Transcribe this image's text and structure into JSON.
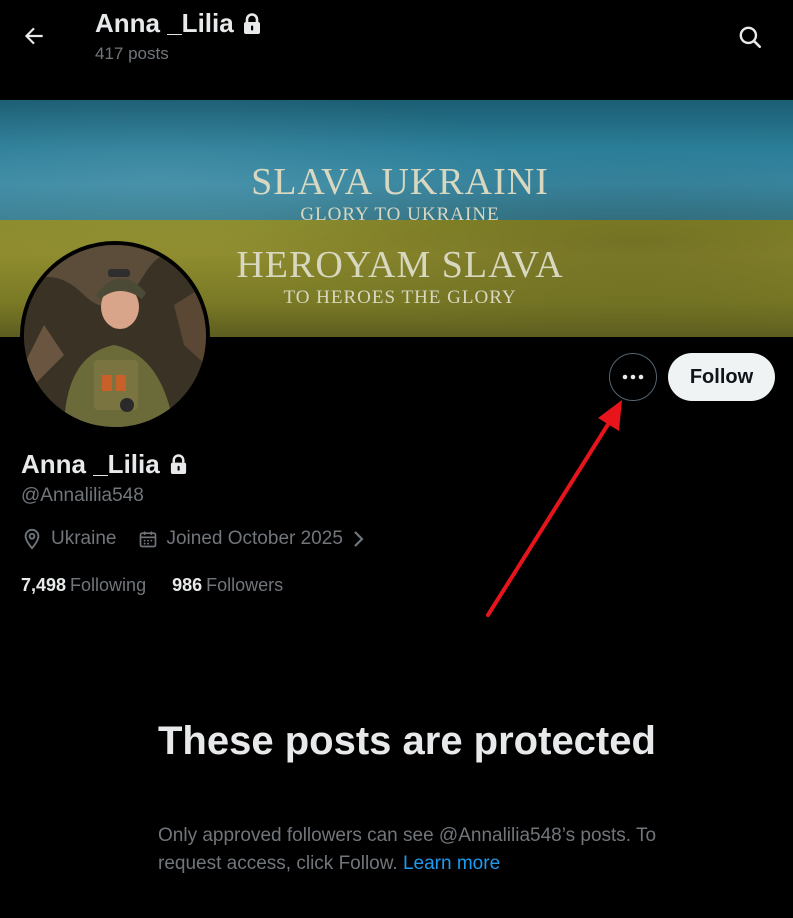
{
  "header": {
    "title": "Anna _Lilia",
    "subtitle": "417 posts"
  },
  "banner": {
    "line1": "SLAVA UKRAINI",
    "line2": "GLORY TO UKRAINE",
    "line3": "HEROYAM SLAVA",
    "line4": "TO HEROES THE GLORY"
  },
  "actions": {
    "follow_label": "Follow"
  },
  "profile": {
    "name": "Anna _Lilia",
    "handle": "@Annalilia548",
    "location": "Ukraine",
    "joined": "Joined October 2025",
    "following_count": "7,498",
    "following_label": "Following",
    "followers_count": "986",
    "followers_label": "Followers"
  },
  "protected": {
    "title": "These posts are protected",
    "body": "Only approved followers can see @Annalilia548’s posts. To request access, click Follow.",
    "learn_more": "Learn more"
  },
  "colors": {
    "background": "#000000",
    "primary_text": "#e7e9ea",
    "secondary_text": "#71767b",
    "link": "#1d9bf0",
    "follow_button": "#eff3f4",
    "annotation_arrow": "#e8141c"
  },
  "icons": {
    "back": "arrow-left-icon",
    "search": "search-icon",
    "lock": "lock-icon",
    "more": "more-horizontal-icon",
    "location": "location-pin-icon",
    "calendar": "calendar-icon",
    "chevron": "chevron-right-icon"
  }
}
